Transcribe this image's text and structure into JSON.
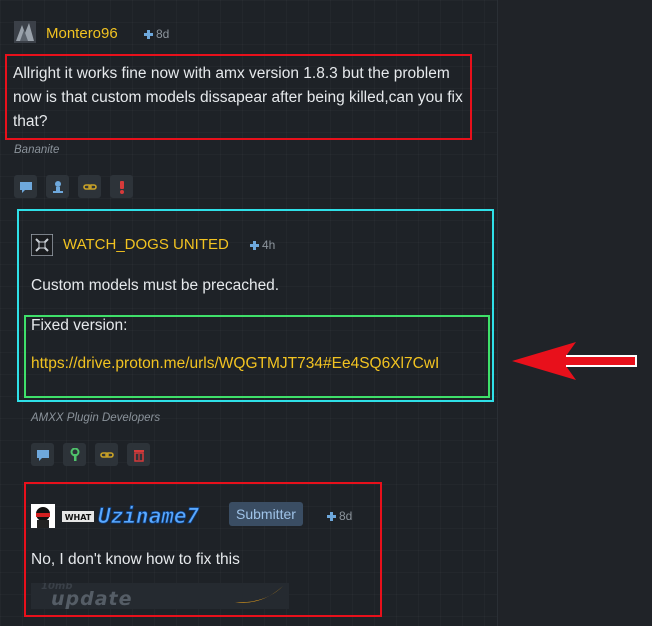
{
  "posts": [
    {
      "username": "Montero96",
      "time": "8d",
      "text": "Allright it works fine now with amx version 1.8.3 but the problem now is that custom models dissapear after being killed,can you fix that?",
      "signature": "Bananite"
    },
    {
      "username": "WATCH_DOGS UNITED",
      "time": "4h",
      "text1": "Custom models must be precached.",
      "text2": "Fixed version:",
      "link": "https://drive.proton.me/urls/WQGTMJT734#Ee4SQ6Xl7CwI",
      "signature": "AMXX Plugin Developers"
    },
    {
      "username_image_text": "Uziname7",
      "username_image_prefix": "WHAT",
      "badge": "Submitter",
      "time": "8d",
      "text": "No, I don't know how to fix this",
      "signature_image_text": "update",
      "signature_image_subtext": "10mb"
    }
  ],
  "colors": {
    "annotation_red": "#e8101b",
    "annotation_cyan": "#2fe0e8",
    "annotation_green": "#3fe06a",
    "username": "#f2c321",
    "background": "#1e2227"
  }
}
